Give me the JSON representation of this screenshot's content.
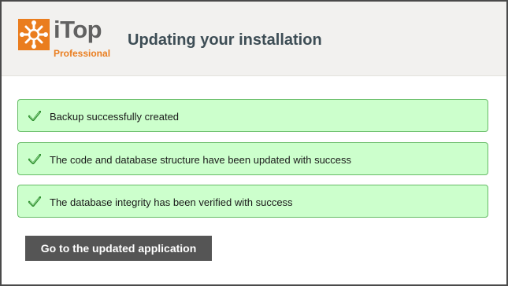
{
  "header": {
    "logo": {
      "icon": "itop-logo-icon",
      "name": "iTop",
      "edition": "Professional",
      "brand_color": "#ea7d1e"
    },
    "title": "Updating your installation"
  },
  "steps": [
    {
      "icon": "check-icon",
      "status": "success",
      "text": "Backup successfully created"
    },
    {
      "icon": "check-icon",
      "status": "success",
      "text": "The code and database structure have been updated with success"
    },
    {
      "icon": "check-icon",
      "status": "success",
      "text": "The database integrity has been verified with success"
    }
  ],
  "actions": {
    "go_label": "Go to the updated application"
  },
  "colors": {
    "success_bg": "#ccffcc",
    "success_border": "#66bb66",
    "button_bg": "#555555"
  }
}
